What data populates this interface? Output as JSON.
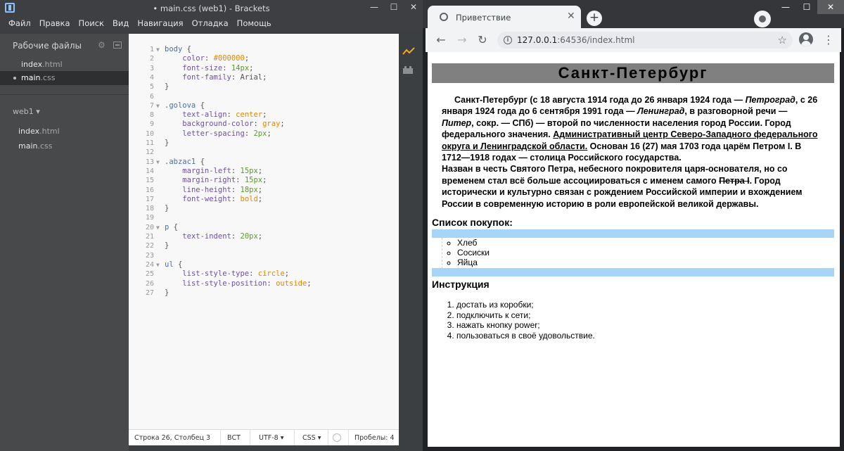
{
  "brackets": {
    "title": "• main.css (web1) - Brackets",
    "menu": [
      "Файл",
      "Правка",
      "Поиск",
      "Вид",
      "Навигация",
      "Отладка",
      "Помощь"
    ],
    "working_files_label": "Рабочие файлы",
    "working_files": [
      {
        "name": "index",
        "ext": ".html"
      },
      {
        "name": "main",
        "ext": ".css"
      }
    ],
    "project_label": "web1 ▾",
    "project_files": [
      {
        "name": "index",
        "ext": ".html"
      },
      {
        "name": "main",
        "ext": ".css"
      }
    ],
    "code_lines": [
      "body {",
      "    color: #000000;",
      "    font-size: 14px;",
      "    font-family: Arial;",
      "}",
      "",
      ".golova {",
      "    text-align: center;",
      "    background-color: gray;",
      "    letter-spacing: 2px;",
      "}",
      "",
      ".abzac1 {",
      "    margin-left: 15px;",
      "    margin-right: 15px;",
      "    line-height: 18px;",
      "    font-weight: bold;",
      "}",
      "",
      "p {",
      "    text-indent: 20px;",
      "}",
      "",
      "ul {",
      "    list-style-type: circle;",
      "    list-style-position: outside;",
      "}"
    ],
    "status": {
      "cursor": "Строка 26, Столбец 3",
      "insert_mode": "ВСТ",
      "encoding": "UTF-8 ▾",
      "language": "CSS ▾",
      "spaces": "Пробелы:  4"
    }
  },
  "chrome": {
    "tab_title": "Приветствие",
    "url_host": "127.0.0.1",
    "url_rest": ":64536/index.html",
    "page": {
      "heading": "Санкт-Петербург",
      "p1": {
        "t1": "Санкт-Петербург (с 18 августа 1914 года до 26 января 1924 года — ",
        "i1": "Петроград",
        "t2": ", с 26 января 1924 года до 6 сентября 1991 года — ",
        "i2": "Ленинград",
        "t3": ", в разговорной речи — ",
        "i3": "Питер",
        "t4": ", сокр. — СПб) — второй по численности населения город России. Город федерального значения. ",
        "u1": "Административный центр Северо-Западного федерального округа и Ленинградской области.",
        "t5": " Основан 16 (27) мая 1703 года царём Петром I. В 1712—1918 годах — столица Российского государства."
      },
      "p2": {
        "t1": "Назван в честь Святого Петра, небесного покровителя царя-основателя, но со временем стал всё больше ассоциироваться с именем самого ",
        "s1": "Петра I",
        "t2": ". Город исторически и культурно связан с рождением Российской империи и вхождением России в современную историю в роли европейской великой державы."
      },
      "shopping_title": "Список покупок:",
      "shopping": [
        "Хлеб",
        "Сосиски",
        "Яйца"
      ],
      "instr_title": "Инструкция",
      "steps": [
        "достать из коробки;",
        "подключить к сети;",
        "нажать кнопку power;",
        "пользоваться в своё удовольствие."
      ]
    }
  }
}
